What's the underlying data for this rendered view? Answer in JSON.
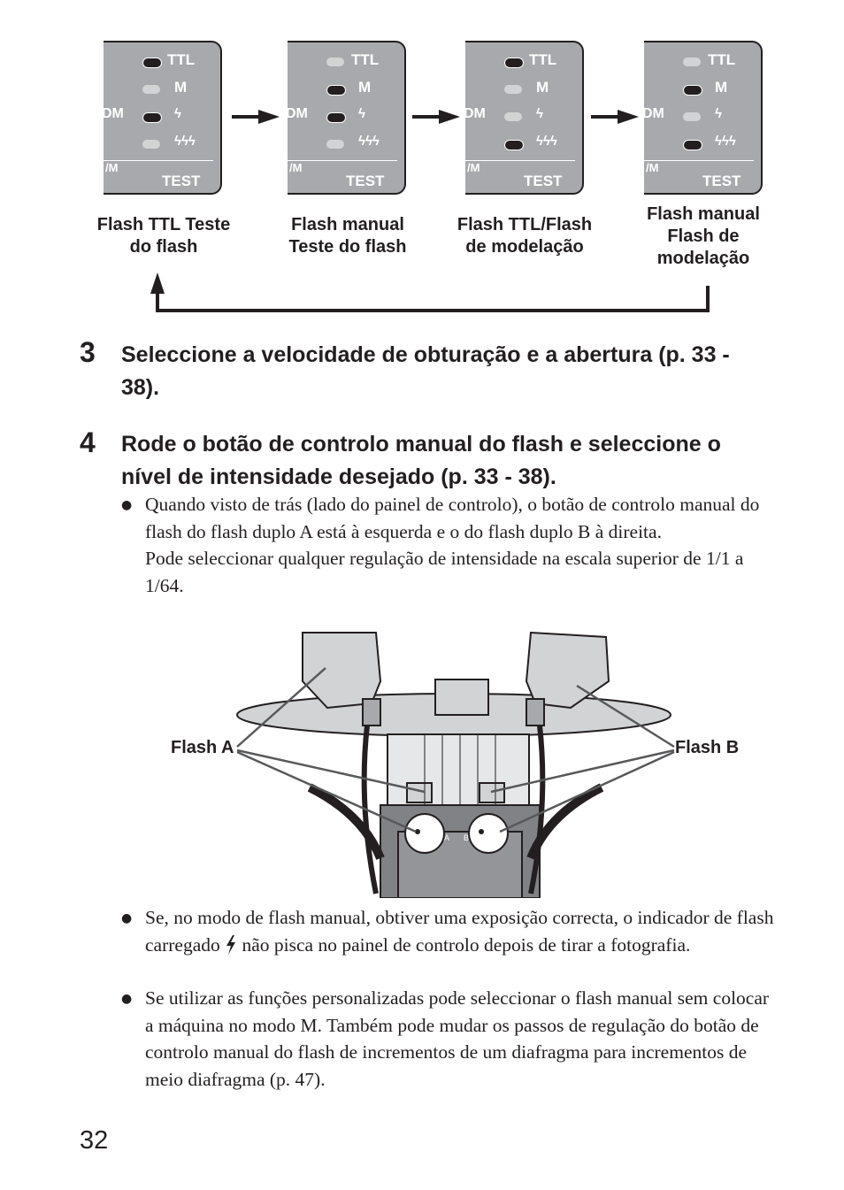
{
  "panel_labels": {
    "ttl": "TTL",
    "m": "M",
    "dm": "DM",
    "slash_m": "/M",
    "test": "TEST"
  },
  "modes": [
    {
      "caption": [
        "Flash TTL Teste",
        "do flash"
      ],
      "leds": {
        "ttl": true,
        "m": false,
        "flash": true,
        "modeling": false
      }
    },
    {
      "caption": [
        "Flash manual",
        "Teste do flash"
      ],
      "leds": {
        "ttl": false,
        "m": true,
        "flash": true,
        "modeling": false
      }
    },
    {
      "caption": [
        "Flash TTL/Flash",
        "de modelação"
      ],
      "leds": {
        "ttl": true,
        "m": false,
        "flash": false,
        "modeling": true
      }
    },
    {
      "caption": [
        "Flash manual",
        "Flash de",
        "modelação"
      ],
      "leds": {
        "ttl": false,
        "m": true,
        "flash": false,
        "modeling": true
      }
    }
  ],
  "steps": [
    {
      "number": "3",
      "heading": "Seleccione a velocidade de obturação e a abertura (p. 33 - 38)."
    },
    {
      "number": "4",
      "heading": "Rode o botão de controlo manual do flash e seleccione o nível de intensidade desejado (p. 33 - 38)."
    }
  ],
  "bullets": {
    "b1": "Quando visto de trás (lado do painel de controlo), o botão de controlo manual do flash do flash duplo A está à esquerda e o do flash duplo B à direita.",
    "b1_extra": "Pode seleccionar qualquer regulação de intensidade na escala superior de 1/1 a 1/64.",
    "b2_pre": "Se, no modo de flash manual, obtiver uma exposição correcta, o indicador de flash carregado",
    "b2_post": "não pisca no painel de controlo depois de tirar a fotografia.",
    "b3": "Se utilizar as funções personalizadas pode seleccionar o flash manual sem colocar a máquina no modo M. Também pode mudar os passos de regulação do botão de controlo manual do flash de incrementos de um diafragma para incrementos de meio diafragma (p. 47)."
  },
  "illustration": {
    "flash_a": "Flash A",
    "flash_b": "Flash B",
    "dial_a": "A",
    "dial_b": "B"
  },
  "page_number": "32"
}
